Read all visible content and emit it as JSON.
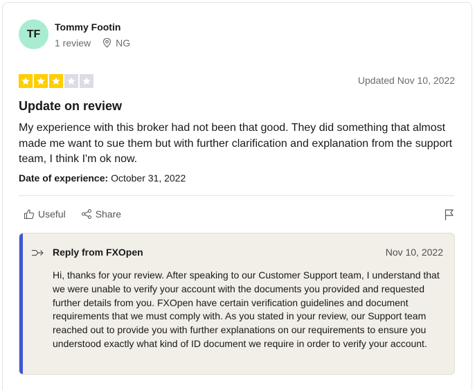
{
  "author": {
    "initials": "TF",
    "name": "Tommy Footin",
    "reviews": "1 review",
    "location": "NG"
  },
  "rating": {
    "value": 3,
    "max": 5,
    "colors": {
      "filled": "#ffce00",
      "empty": "#dcdce6"
    }
  },
  "updated": "Updated Nov 10, 2022",
  "review": {
    "title": "Update on review",
    "body": "My experience with this broker had not been that good. They did something that almost made me want to sue them but with further clarification and explanation from the support team, I think I'm ok now.",
    "date_label": "Date of experience:",
    "date_value": "October 31, 2022"
  },
  "actions": {
    "useful_label": "Useful",
    "share_label": "Share",
    "useful_icon": "thumbs-up-icon",
    "share_icon": "share-icon",
    "flag_icon": "flag-icon"
  },
  "reply": {
    "from": "Reply from FXOpen",
    "date": "Nov 10, 2022",
    "icon": "reply-arrow-icon",
    "accent": "#3d57d3",
    "text": "Hi, thanks for your review. After speaking to our Customer Support team, I understand that we were unable to verify your account with the documents you provided and requested further details from you. FXOpen have certain verification guidelines and document requirements that we must comply with. As you stated in your review, our Support team reached out to provide you with further explanations on our requirements to ensure you understood exactly what kind of ID document we require in order to verify your account."
  }
}
